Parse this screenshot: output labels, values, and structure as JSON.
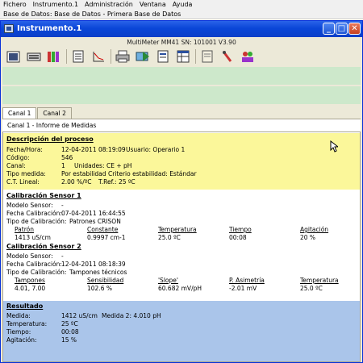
{
  "menu": [
    "Fichero",
    "Instrumento.1",
    "Administración",
    "Ventana",
    "Ayuda"
  ],
  "path": "Base de Datos: Base de Datos - Primera Base de Datos",
  "window": {
    "title": "Instrumento.1",
    "device": "MultiMeter MM41  SN: 101001  V3.90",
    "buttons": {
      "minimize": "_",
      "maximize": "□",
      "close": "✕"
    }
  },
  "toolbar_icons": [
    "instrument-icon",
    "keyboard-icon",
    "buffers-icon",
    "report-icon",
    "graph-icon",
    "print-icon",
    "export-icon",
    "edit-report-icon",
    "table-icon",
    "notes-icon",
    "probe-icon",
    "users-icon"
  ],
  "tabs": [
    "Canal 1",
    "Canal 2"
  ],
  "subheader": "Canal 1  - Informe de Medidas",
  "proceso": {
    "title": "Descripción del proceso",
    "fecha_label": "Fecha/Hora:",
    "fecha": "12-04-2011 08:19:09",
    "usuario": "Usuario: Operario 1",
    "codigo_label": "Código:",
    "codigo": "546",
    "canal_label": "Canal:",
    "canal": "1",
    "unidades": "Unidades:",
    "unidades_val": "CE + pH",
    "tipo_label": "Tipo medida:",
    "tipo": "Por estabilidad",
    "criterio": "Criterio estabilidad: Estándar",
    "ct_label": "C.T. Lineal:",
    "ct": "2.00 %/ºC",
    "tref": "T.Ref.: 25 ºC"
  },
  "cal1": {
    "title": "Calibración Sensor 1",
    "modelo_label": "Modelo Sensor:",
    "modelo": "-",
    "fecha_label": "Fecha Calibración:",
    "fecha": "07-04-2011 16:44:55",
    "tipo_label": "Tipo de Calibración:",
    "tipo": "Patrones CRISON",
    "headers": [
      "Patrón",
      "Constante",
      "Temperatura",
      "Tiempo",
      "Agitación"
    ],
    "values": [
      "1413 uS/cm",
      "0.9997 cm-1",
      "25.0 ºC",
      "00:08",
      "20 %"
    ]
  },
  "cal2": {
    "title": "Calibración Sensor 2",
    "modelo_label": "Modelo Sensor:",
    "modelo": "-",
    "fecha_label": "Fecha Calibración:",
    "fecha": "12-04-2011 08:18:39",
    "tipo_label": "Tipo de Calibración:",
    "tipo": "Tampones técnicos",
    "headers": [
      "Tampones",
      "Sensibilidad",
      "'Slope'",
      "P. Asimetría",
      "Temperatura"
    ],
    "values": [
      "4.01, 7.00",
      "102.6 %",
      "60.682 mV/pH",
      "-2.01 mV",
      "25.0 ºC"
    ]
  },
  "resultado": {
    "title": "Resultado",
    "medida_label": "Medida:",
    "medida": "1412 uS/cm",
    "medida2": "Medida 2: 4.010 pH",
    "temp_label": "Temperatura:",
    "temp": "25 ºC",
    "tiempo_label": "Tiempo:",
    "tiempo": "00:08",
    "agit_label": "Agitación:",
    "agit": "15 %"
  }
}
